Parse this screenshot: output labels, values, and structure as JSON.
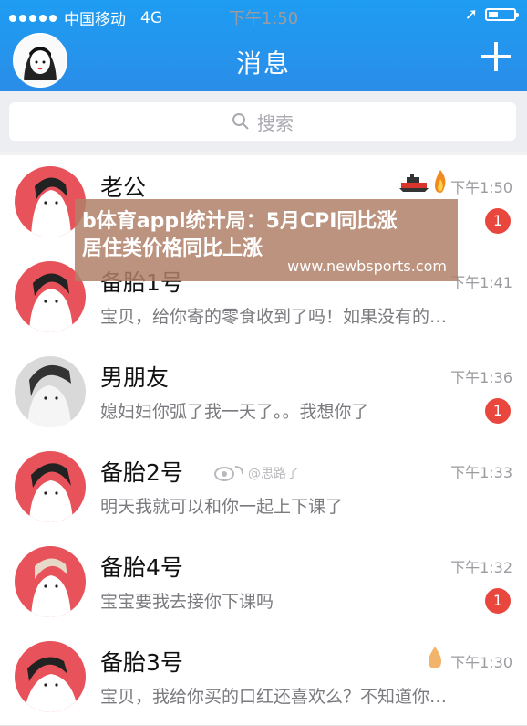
{
  "status": {
    "carrier": "中国移动",
    "network": "4G",
    "time": "下午1:50",
    "battery_level": 0.4
  },
  "nav": {
    "title": "消息"
  },
  "search": {
    "placeholder": "搜索"
  },
  "conversations": [
    {
      "name": "老公",
      "message": "",
      "time": "下午1:50",
      "badge": "1",
      "avatar_color": "#e8525a"
    },
    {
      "name": "备胎1号",
      "message": "宝贝，给你寄的零食收到了吗！如果没有的…",
      "time": "下午1:41",
      "badge": "",
      "avatar_color": "#e8525a"
    },
    {
      "name": "男朋友",
      "message": "媳妇妇你弧了我一天了。。我想你了",
      "time": "下午1:36",
      "badge": "1",
      "avatar_color": "#d9d9d9"
    },
    {
      "name": "备胎2号",
      "message": "明天我就可以和你一起上下课了",
      "time": "下午1:33",
      "badge": "",
      "avatar_color": "#e8525a"
    },
    {
      "name": "备胎4号",
      "message": "宝宝要我去接你下课吗",
      "time": "下午1:32",
      "badge": "1",
      "avatar_color": "#e8525a"
    },
    {
      "name": "备胎3号",
      "message": "宝贝，我给你买的口红还喜欢么？不知道你…",
      "time": "下午1:30",
      "badge": "",
      "avatar_color": "#e8525a"
    }
  ],
  "overlay": {
    "line1": "b体育appl统计局：5月CPI同比涨",
    "line2": "居住类价格同比上涨",
    "url": "www.newbsports.com"
  },
  "watermark": {
    "text": "@思路了"
  }
}
